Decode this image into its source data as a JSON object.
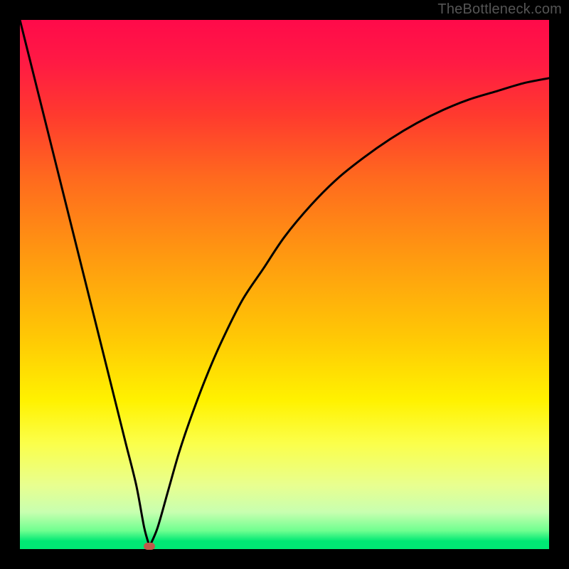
{
  "watermark": "TheBottleneck.com",
  "gradient": {
    "stops": [
      {
        "offset": 0.0,
        "color": "#ff0a4a"
      },
      {
        "offset": 0.08,
        "color": "#ff1a44"
      },
      {
        "offset": 0.18,
        "color": "#ff3a2e"
      },
      {
        "offset": 0.3,
        "color": "#ff6a1e"
      },
      {
        "offset": 0.45,
        "color": "#ff9a10"
      },
      {
        "offset": 0.6,
        "color": "#ffc805"
      },
      {
        "offset": 0.72,
        "color": "#fff200"
      },
      {
        "offset": 0.8,
        "color": "#fbff4a"
      },
      {
        "offset": 0.88,
        "color": "#e8ff90"
      },
      {
        "offset": 0.93,
        "color": "#c8ffb0"
      },
      {
        "offset": 0.965,
        "color": "#70ff90"
      },
      {
        "offset": 0.985,
        "color": "#00e874"
      },
      {
        "offset": 1.0,
        "color": "#00e874"
      }
    ]
  },
  "curve": {
    "stroke": "#000000",
    "stroke_width": 3
  },
  "marker": {
    "color": "#c05a4a"
  },
  "chart_data": {
    "type": "line",
    "title": "",
    "xlabel": "",
    "ylabel": "",
    "xlim": [
      0,
      100
    ],
    "ylim": [
      0,
      100
    ],
    "x": [
      0,
      2,
      4,
      6,
      8,
      10,
      12,
      14,
      16,
      18,
      20,
      22,
      23.5,
      24.5,
      26,
      28,
      30,
      32,
      35,
      38,
      42,
      46,
      50,
      55,
      60,
      65,
      70,
      75,
      80,
      85,
      90,
      95,
      100
    ],
    "y": [
      100,
      92,
      84,
      76,
      68,
      60,
      52,
      44,
      36,
      28,
      20,
      12,
      4,
      0.5,
      4,
      11,
      18,
      24,
      32,
      39,
      47,
      53,
      59,
      65,
      70,
      74,
      77.5,
      80.5,
      83,
      85,
      86.5,
      88,
      89
    ],
    "minimum": {
      "x": 24.5,
      "y": 0.5
    },
    "note": "Values estimated from pixel positions; axes are implied 0–100 on both. Curve is a V/check-shape with vertex near x≈24.5 and asymptotic rise toward y≈89 at x=100."
  }
}
